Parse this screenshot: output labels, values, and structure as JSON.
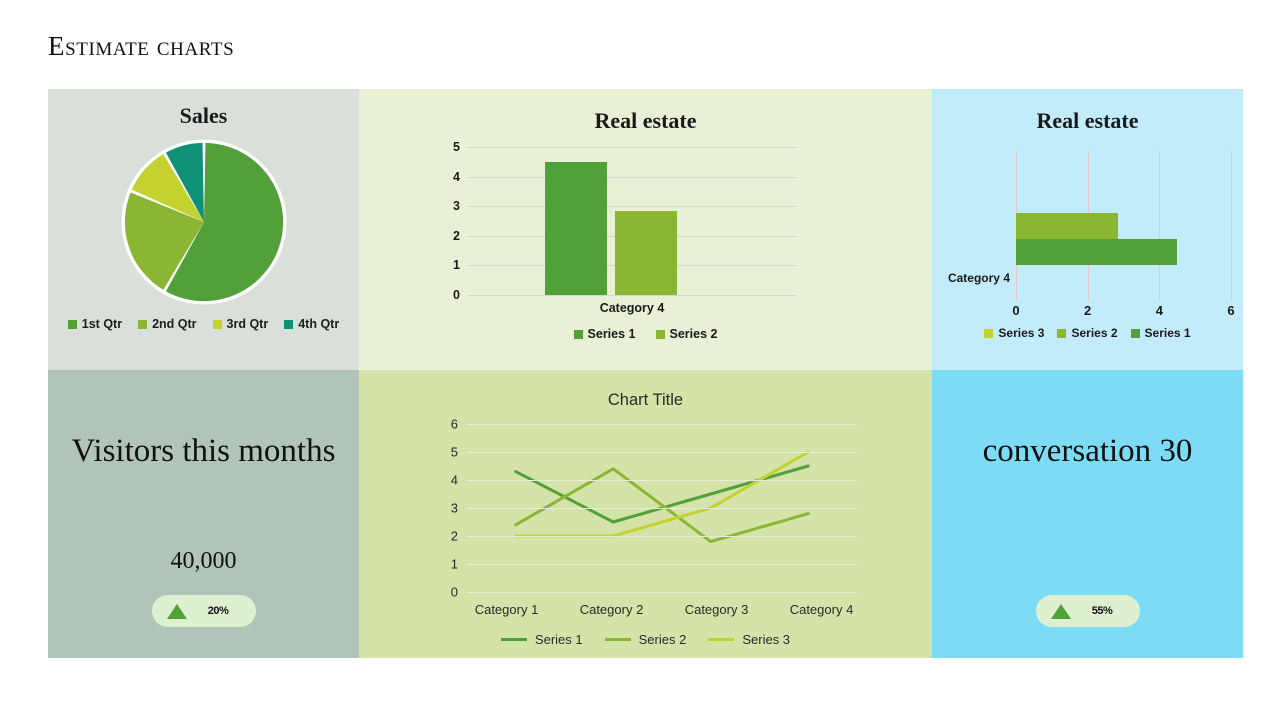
{
  "slide": {
    "title": "Estimate charts"
  },
  "colors": {
    "series1": "#52a03a",
    "series2": "#8ab633",
    "series3": "#c3d22e",
    "qtr4": "#0f9178",
    "panel_sales_bg": "#d9dfd9",
    "panel_bar_bg": "#e8f1d6",
    "panel_hbar_bg": "#c3ecfa",
    "panel_visitors_bg": "#b0c5b8",
    "panel_line_bg": "#d4e3a8",
    "panel_conversation_bg": "#7cdcf5",
    "badge_bg": "#dff0d0",
    "badge_arrow": "#51a039"
  },
  "panels": {
    "visitors": {
      "heading": "Visitors this months",
      "value": "40,000",
      "badge_percent": "20%",
      "badge_icon": "triangle-up-icon"
    },
    "conversation": {
      "heading": "conversation 30",
      "badge_percent": "55%",
      "badge_icon": "triangle-up-icon"
    }
  },
  "chart_data": [
    {
      "type": "pie",
      "title": "Sales",
      "labels": [
        "1st Qtr",
        "2nd Qtr",
        "3rd Qtr",
        "4th Qtr"
      ],
      "values": [
        58.3,
        23.1,
        10.3,
        8.3
      ],
      "colors": [
        "#52a03a",
        "#8ab633",
        "#c3d22e",
        "#0f9178"
      ],
      "legend_position": "bottom",
      "start_angle": 0,
      "grid": false
    },
    {
      "type": "bar",
      "title": "Real estate",
      "categories": [
        "Category 4"
      ],
      "series": [
        {
          "name": "Series 1",
          "values": [
            4.5
          ],
          "color": "#52a03a"
        },
        {
          "name": "Series 2",
          "values": [
            2.85
          ],
          "color": "#8ab633"
        }
      ],
      "xlabel": "Category 4",
      "ylabel": "",
      "ylim": [
        0,
        5
      ],
      "yticks": [
        0,
        1,
        2,
        3,
        4,
        5
      ],
      "grid": true,
      "legend_position": "bottom",
      "orientation": "vertical"
    },
    {
      "type": "bar",
      "title": "Real estate",
      "categories": [
        "Category 4"
      ],
      "series": [
        {
          "name": "Series 3",
          "values": [
            0
          ],
          "color": "#c3d22e"
        },
        {
          "name": "Series 2",
          "values": [
            2.85
          ],
          "color": "#8ab633"
        },
        {
          "name": "Series 1",
          "values": [
            4.5
          ],
          "color": "#52a03a"
        }
      ],
      "xlabel": "",
      "ylabel": "Category 4",
      "xlim": [
        0,
        6
      ],
      "xticks": [
        0,
        2,
        4,
        6
      ],
      "grid": true,
      "legend_position": "bottom",
      "orientation": "horizontal"
    },
    {
      "type": "line",
      "title": "Chart Title",
      "categories": [
        "Category 1",
        "Category 2",
        "Category 3",
        "Category 4"
      ],
      "series": [
        {
          "name": "Series 1",
          "values": [
            4.3,
            2.5,
            3.5,
            4.5
          ],
          "color": "#52a03a"
        },
        {
          "name": "Series 2",
          "values": [
            2.4,
            4.4,
            1.8,
            2.8
          ],
          "color": "#8ab633"
        },
        {
          "name": "Series 3",
          "values": [
            2.0,
            2.0,
            3.0,
            5.0
          ],
          "color": "#c3d22e"
        }
      ],
      "xlabel": "",
      "ylabel": "",
      "ylim": [
        0,
        6
      ],
      "yticks": [
        0,
        1,
        2,
        3,
        4,
        5,
        6
      ],
      "grid": true,
      "legend_position": "bottom"
    }
  ]
}
